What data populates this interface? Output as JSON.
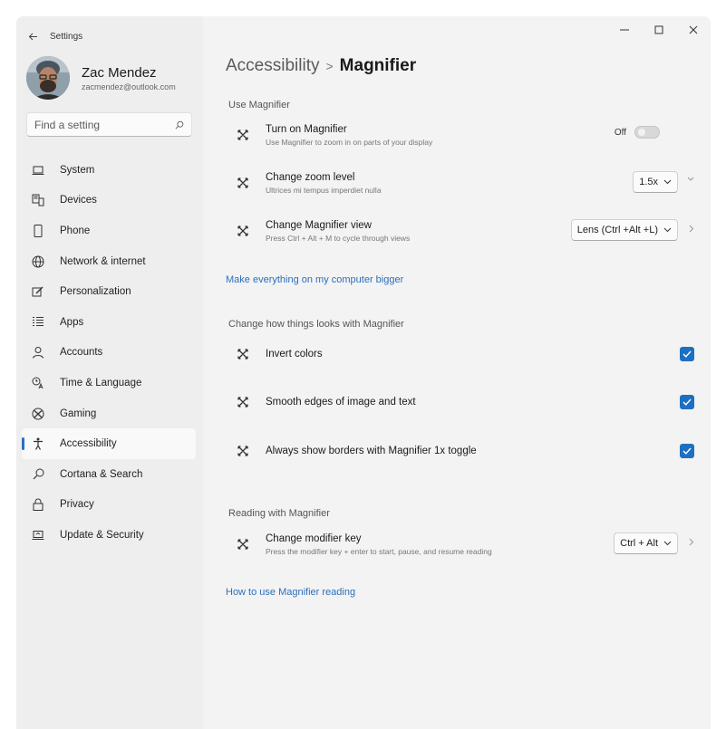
{
  "app": {
    "title": "Settings"
  },
  "profile": {
    "name": "Zac Mendez",
    "email": "zacmendez@outlook.com"
  },
  "search": {
    "placeholder": "Find a setting"
  },
  "sidebar": {
    "items": [
      {
        "label": "System",
        "icon": "laptop-icon"
      },
      {
        "label": "Devices",
        "icon": "devices-icon"
      },
      {
        "label": "Phone",
        "icon": "phone-icon"
      },
      {
        "label": "Network & internet",
        "icon": "globe-icon"
      },
      {
        "label": "Personalization",
        "icon": "brush-icon"
      },
      {
        "label": "Apps",
        "icon": "apps-list-icon"
      },
      {
        "label": "Accounts",
        "icon": "person-icon"
      },
      {
        "label": "Time & Language",
        "icon": "clock-language-icon"
      },
      {
        "label": "Gaming",
        "icon": "xbox-icon"
      },
      {
        "label": "Accessibility",
        "icon": "accessibility-icon",
        "active": true
      },
      {
        "label": "Cortana & Search",
        "icon": "search-icon"
      },
      {
        "label": "Privacy",
        "icon": "lock-icon"
      },
      {
        "label": "Update & Security",
        "icon": "update-icon"
      }
    ]
  },
  "breadcrumb": {
    "parent": "Accessibility",
    "separator": ">",
    "current": "Magnifier"
  },
  "sections": {
    "use_magnifier": {
      "title": "Use Magnifier",
      "turn_on": {
        "title": "Turn on Magnifier",
        "desc": "Use Magnifier to zoom in on parts of your display",
        "toggle_label": "Off"
      },
      "zoom": {
        "title": "Change zoom level",
        "desc": "Ultrices mi tempus imperdiet nulla",
        "value": "1.5x"
      },
      "view": {
        "title": "Change Magnifier view",
        "desc": "Press Ctrl + Alt + M to cycle through views",
        "value": "Lens (Ctrl +Alt +L)"
      }
    },
    "link_bigger": "Make everything on my computer bigger",
    "looks": {
      "title": "Change how things looks with Magnifier",
      "invert": "Invert colors",
      "smooth": "Smooth edges of image and text",
      "borders": "Always show borders with Magnifier 1x toggle"
    },
    "reading": {
      "title": "Reading with Magnifier",
      "modifier": {
        "title": "Change modifier key",
        "desc": "Press the modifier key + enter to start, pause, and resume reading",
        "value": "Ctrl + Alt"
      }
    },
    "link_reading": "How to use Magnifier reading"
  },
  "colors": {
    "accent": "#1d6fc2",
    "link": "#2b6fbd",
    "sidebar_bg": "#eeeeee",
    "content_bg": "#f3f3f3"
  }
}
